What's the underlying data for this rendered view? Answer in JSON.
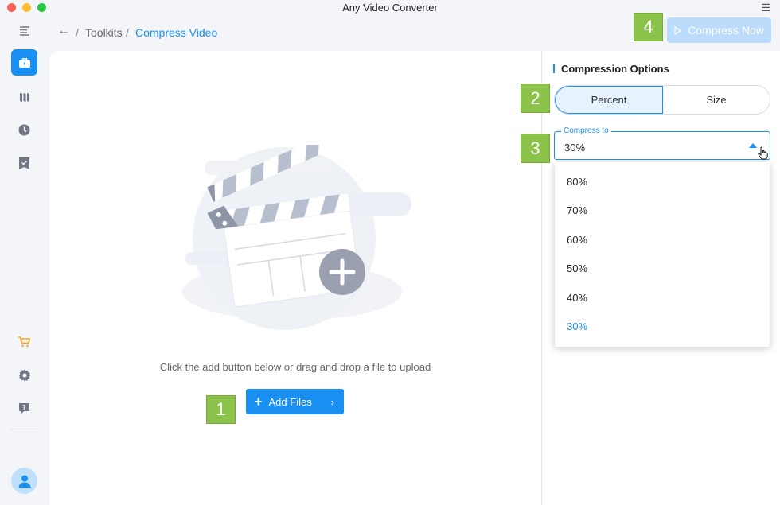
{
  "window": {
    "title": "Any Video Converter",
    "menu_glyph": "☰"
  },
  "breadcrumb": {
    "back_glyph": "←",
    "separator": "/",
    "toolkits": "Toolkits",
    "current": "Compress Video"
  },
  "toolbar": {
    "compress_now_label": "Compress Now",
    "compress_now_icon": "play-outline-icon"
  },
  "sidebar": {
    "items": [
      {
        "name": "menu-icon"
      },
      {
        "name": "toolbox-icon",
        "active": true
      },
      {
        "name": "library-icon"
      },
      {
        "name": "history-icon"
      },
      {
        "name": "bookmark-check-icon"
      }
    ],
    "bottom": [
      {
        "name": "cart-icon"
      },
      {
        "name": "gear-icon"
      },
      {
        "name": "help-icon"
      }
    ]
  },
  "main": {
    "upload_hint": "Click the add button below or drag and drop a file to upload",
    "add_files_label": "Add Files",
    "add_files_plus": "+",
    "add_files_arrow": "›"
  },
  "options": {
    "title": "Compression Options",
    "modes": [
      "Percent",
      "Size"
    ],
    "active_mode": "Percent",
    "compress_to_label": "Compress to",
    "compress_to_value": "30%",
    "dropdown_options": [
      "80%",
      "70%",
      "60%",
      "50%",
      "40%",
      "30%"
    ],
    "selected_option": "30%"
  },
  "badges": [
    "1",
    "2",
    "3",
    "4"
  ],
  "colors": {
    "accent": "#1a8ff2",
    "badge": "#8bc34a"
  }
}
